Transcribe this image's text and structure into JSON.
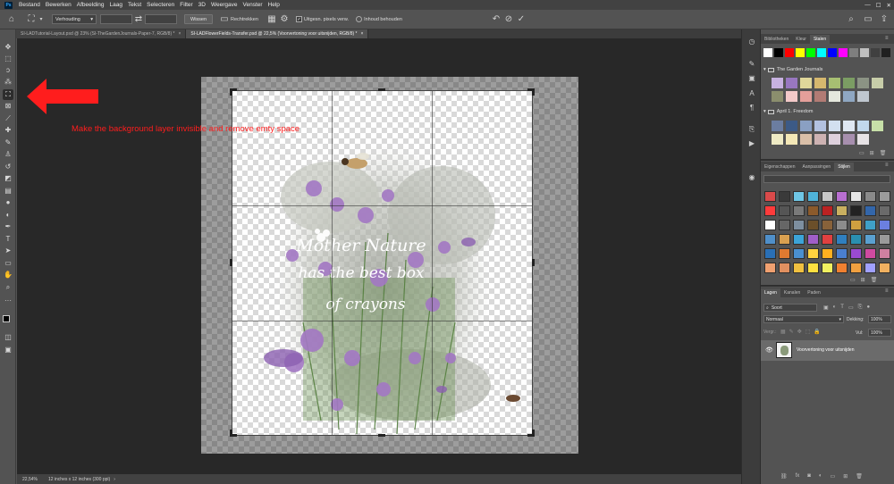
{
  "menu": {
    "logo": "Ps",
    "items": [
      "Bestand",
      "Bewerken",
      "Afbeelding",
      "Laag",
      "Tekst",
      "Selecteren",
      "Filter",
      "3D",
      "Weergave",
      "Venster",
      "Help"
    ]
  },
  "options_bar": {
    "ratio_select": "Verhouding",
    "clear_button": "Wissen",
    "straighten_label": "Rechtrekken",
    "delete_cropped_label": "Uitgesn. pixels verw.",
    "delete_cropped_checked": true,
    "content_aware_label": "Inhoud behouden",
    "undo_icon": "undo-icon",
    "cancel_icon": "cancel-icon",
    "commit_icon": "checkmark-icon"
  },
  "tabs": [
    {
      "label": "SI-LADTutorial-Layout.psd @ 23% (SI-TheGardenJournals-Paper-7, RGB/8) *",
      "close": "×",
      "active": false
    },
    {
      "label": "SI-LADFlowerFields-Transfer.psd @ 22,5% (Voorvertoning voor uitsnijden, RGB/8) *",
      "close": "×",
      "active": true
    }
  ],
  "annotation": {
    "text": "Make the background layer invisible and remove emty space",
    "color": "#ff1d1d"
  },
  "canvas": {
    "overlay_lines": [
      "Mother Nature",
      "has the best box",
      "of crayons"
    ]
  },
  "status": {
    "zoom": "22,54%",
    "doc_size": "12 inches x 12 inches (300 ppi)"
  },
  "swatches_panel": {
    "tabs": [
      "Bibliotheken",
      "Kleur",
      "Stalen"
    ],
    "active_tab": "Stalen",
    "groups": [
      {
        "name": "The Garden Journals"
      },
      {
        "name": "April 1. Freedom"
      }
    ]
  },
  "styles_panel": {
    "tabs": [
      "Eigenschappen",
      "Aanpassingen",
      "Stijlen"
    ],
    "active_tab": "Stijlen"
  },
  "layers_panel": {
    "tabs": [
      "Lagen",
      "Kanalen",
      "Paden"
    ],
    "active_tab": "Lagen",
    "search_placeholder": "Soort",
    "blend_mode": "Normaal",
    "opacity_label": "Dekking:",
    "opacity_value": "100%",
    "lock_label": "Vergr.:",
    "fill_label": "Vul:",
    "fill_value": "100%",
    "layers": [
      {
        "name": "Voorvertoning voor uitsnijden",
        "visible": true
      }
    ]
  },
  "colors": {
    "accent": "#ff1d1d",
    "top_row": [
      "#ffffff",
      "#000000",
      "#ff0000",
      "#ffff00",
      "#00ff00",
      "#00ffff",
      "#0000ff",
      "#ff00ff",
      "#7f7f7f",
      "#bfbfbf",
      "#404040",
      "#202020"
    ],
    "garden": [
      "#c8b2e1",
      "#9877c0",
      "#e0d79a",
      "#d6b86e",
      "#a7bf72",
      "#7b9d63",
      "#8b9384",
      "#c7cda9",
      "#8b8e6d",
      "#f3c9c8",
      "#e49f9a",
      "#b27b74",
      "#e5e8dd",
      "#8fa7c2",
      "#bfc7cf"
    ],
    "freedom": [
      "#6b7da0",
      "#3c5a86",
      "#8aa0c3",
      "#b3c2e0",
      "#d2e0f0",
      "#dfe7f2",
      "#c2d8ec",
      "#c7e0a8",
      "#eeeac4",
      "#f3e7b6",
      "#d9bfa8",
      "#cdb2b2",
      "#ddd0dc",
      "#a78fae",
      "#e7e3e6"
    ]
  }
}
